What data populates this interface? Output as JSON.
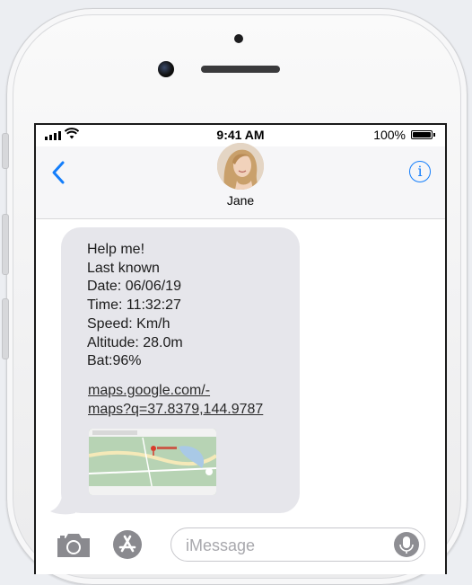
{
  "status_bar": {
    "time": "9:41 AM",
    "battery_percent": "100%",
    "signal_bars": 4,
    "icons": [
      "signal-icon",
      "wifi-icon",
      "battery-icon"
    ]
  },
  "header": {
    "contact_name": "Jane",
    "back_icon": "chevron-left-icon",
    "info_icon": "info-icon",
    "info_glyph": "i",
    "accent_color": "#147efb"
  },
  "message": {
    "lines": [
      "Help me!",
      "Last known",
      "Date: 06/06/19",
      "Time: 11:32:27",
      "Speed: Km/h",
      "Altitude: 28.0m",
      "Bat:96%"
    ],
    "link_lines": [
      "maps.google.com/-",
      "maps?q=37.8379,144.9787"
    ],
    "bubble_color": "#e6e6eb"
  },
  "input_bar": {
    "placeholder": "iMessage",
    "icons": [
      "camera-icon",
      "app-store-icon",
      "microphone-icon"
    ]
  }
}
